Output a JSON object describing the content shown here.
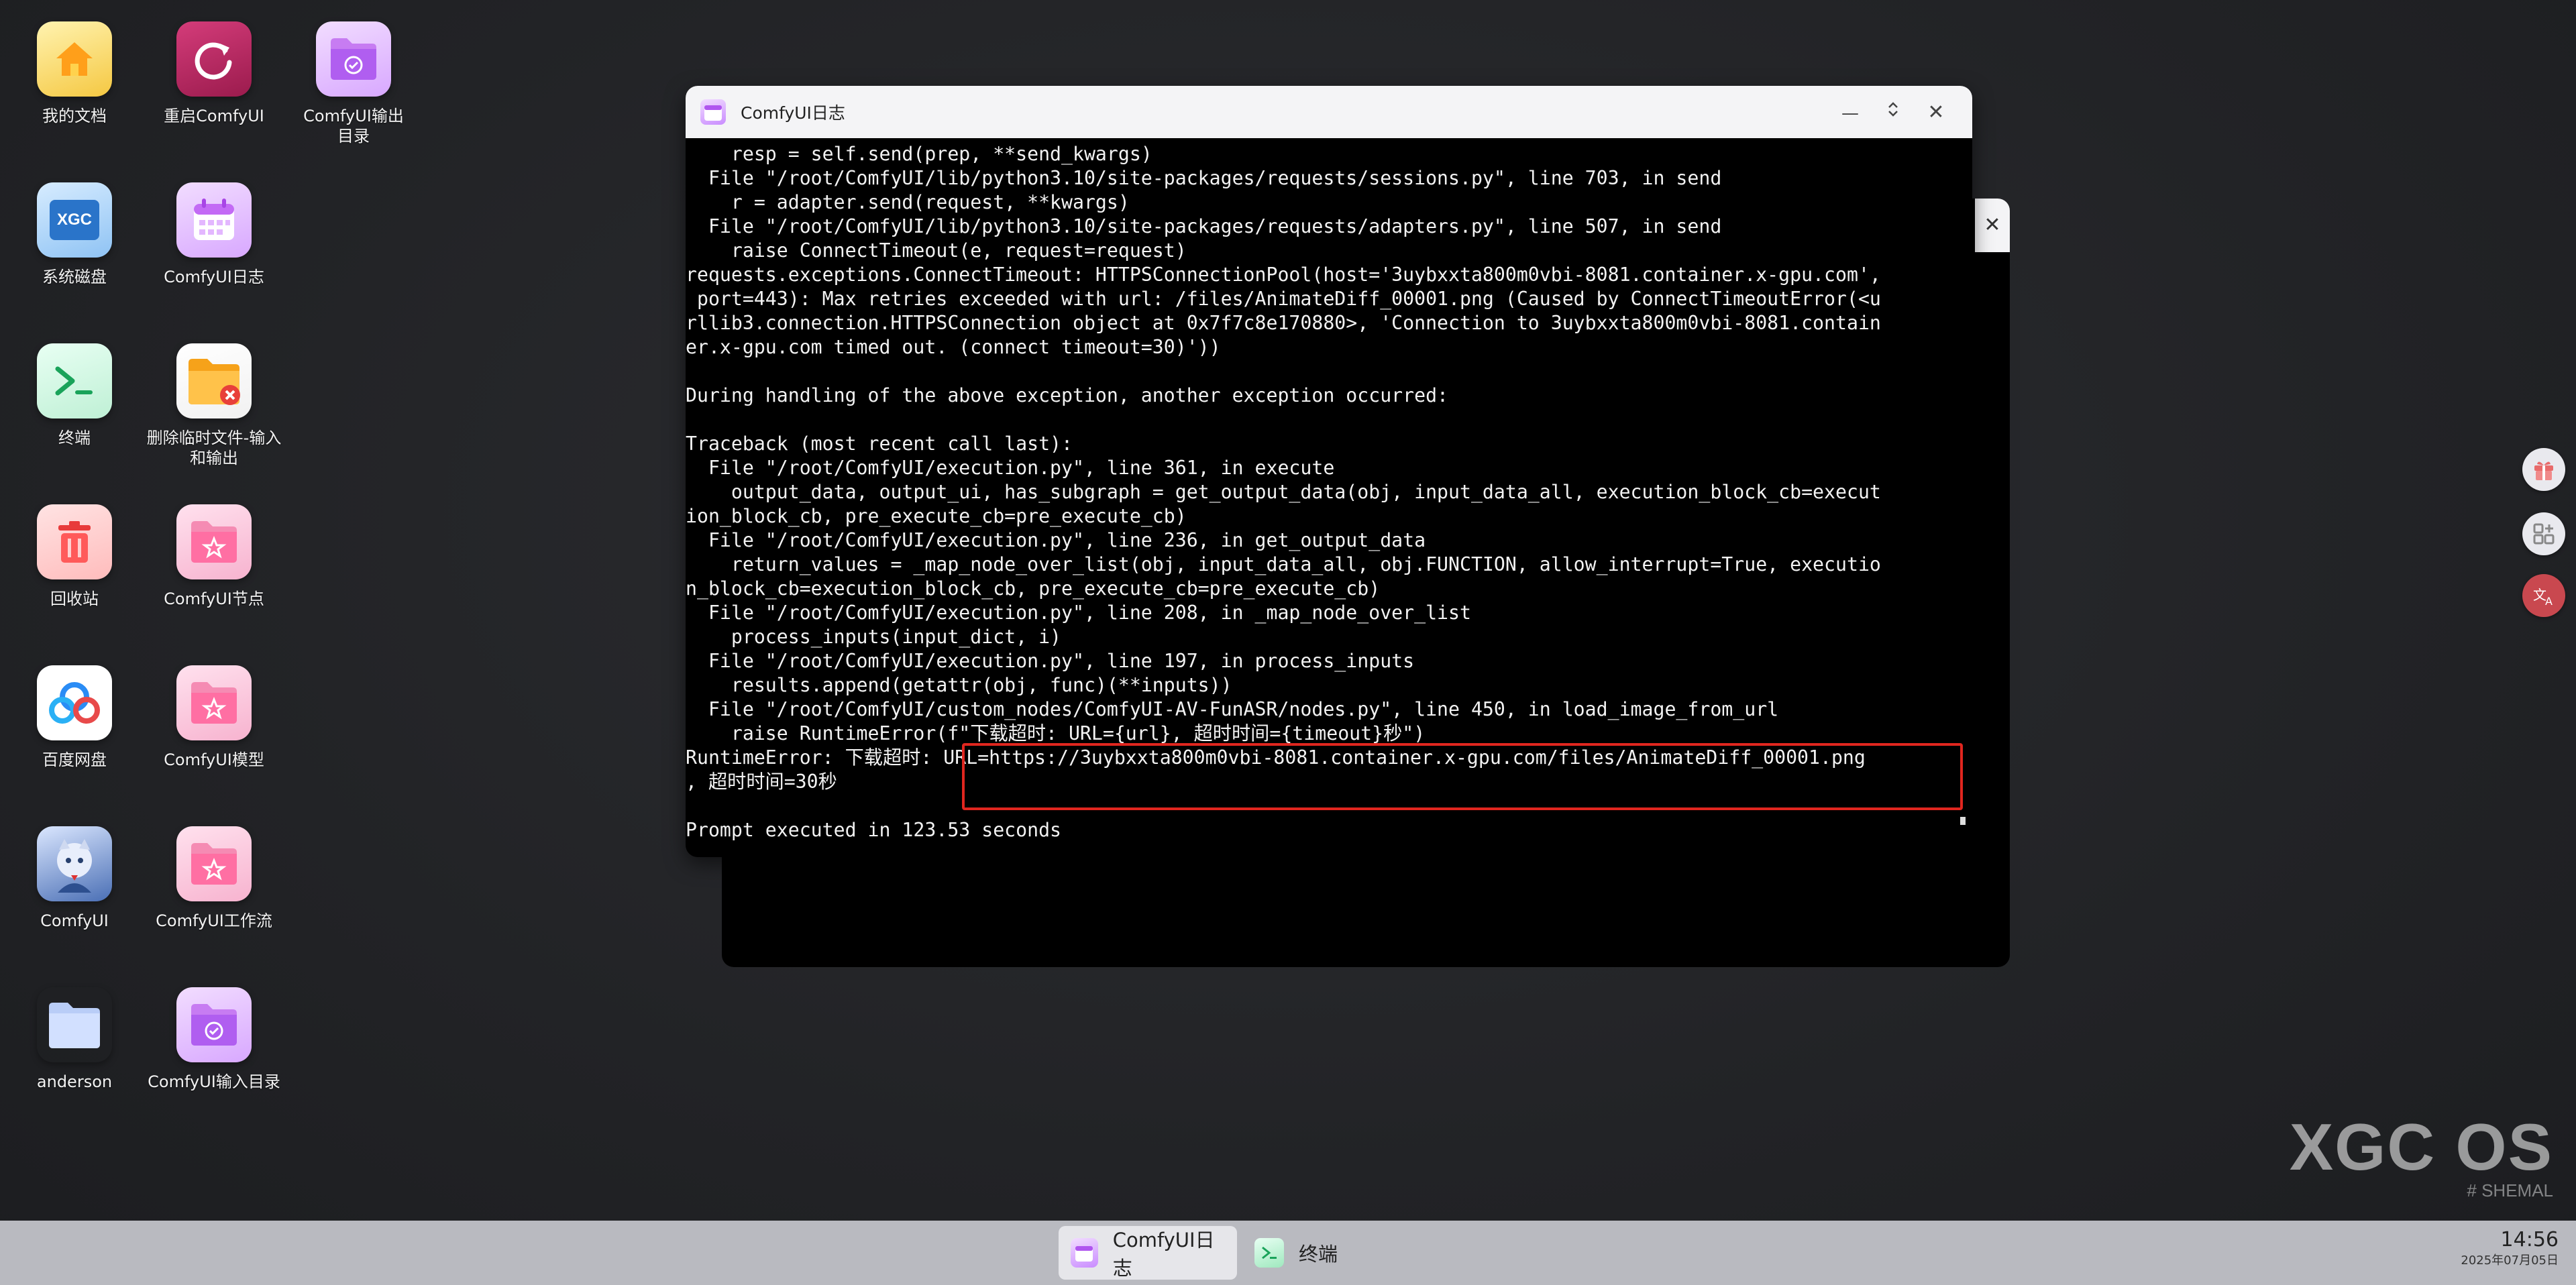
{
  "desktop_icons": [
    {
      "label": "我的文档"
    },
    {
      "label": "重启ComfyUI"
    },
    {
      "label": "ComfyUI输出目录"
    },
    {
      "label": "系统磁盘",
      "badge": "XGC"
    },
    {
      "label": "ComfyUI日志"
    },
    {
      "label": "终端"
    },
    {
      "label": "删除临时文件-输入和输出"
    },
    {
      "label": "回收站"
    },
    {
      "label": "ComfyUI节点"
    },
    {
      "label": "百度网盘"
    },
    {
      "label": "ComfyUI模型"
    },
    {
      "label": "ComfyUI"
    },
    {
      "label": "ComfyUI工作流"
    },
    {
      "label": "anderson"
    },
    {
      "label": "ComfyUI输入目录"
    }
  ],
  "window": {
    "title": "ComfyUI日志",
    "minimize": "—",
    "maximize": "⌃⌄",
    "close": "✕",
    "log": "    resp = self.send(prep, **send_kwargs)\n  File \"/root/ComfyUI/lib/python3.10/site-packages/requests/sessions.py\", line 703, in send\n    r = adapter.send(request, **kwargs)\n  File \"/root/ComfyUI/lib/python3.10/site-packages/requests/adapters.py\", line 507, in send\n    raise ConnectTimeout(e, request=request)\nrequests.exceptions.ConnectTimeout: HTTPSConnectionPool(host='3uybxxta800m0vbi-8081.container.x-gpu.com',\n port=443): Max retries exceeded with url: /files/AnimateDiff_00001.png (Caused by ConnectTimeoutError(<u\nrllib3.connection.HTTPSConnection object at 0x7f7c8e170880>, 'Connection to 3uybxxta800m0vbi-8081.contain\ner.x-gpu.com timed out. (connect timeout=30)'))\n\nDuring handling of the above exception, another exception occurred:\n\nTraceback (most recent call last):\n  File \"/root/ComfyUI/execution.py\", line 361, in execute\n    output_data, output_ui, has_subgraph = get_output_data(obj, input_data_all, execution_block_cb=execut\nion_block_cb, pre_execute_cb=pre_execute_cb)\n  File \"/root/ComfyUI/execution.py\", line 236, in get_output_data\n    return_values = _map_node_over_list(obj, input_data_all, obj.FUNCTION, allow_interrupt=True, executio\nn_block_cb=execution_block_cb, pre_execute_cb=pre_execute_cb)\n  File \"/root/ComfyUI/execution.py\", line 208, in _map_node_over_list\n    process_inputs(input_dict, i)\n  File \"/root/ComfyUI/execution.py\", line 197, in process_inputs\n    results.append(getattr(obj, func)(**inputs))\n  File \"/root/ComfyUI/custom_nodes/ComfyUI-AV-FunASR/nodes.py\", line 450, in load_image_from_url\n    raise RuntimeError(f\"下载超时: URL={url}, 超时时间={timeout}秒\")\nRuntimeError: 下载超时: URL=https://3uybxxta800m0vbi-8081.container.x-gpu.com/files/AnimateDiff_00001.png\n, 超时时间=30秒\n\nPrompt executed in 123.53 seconds"
  },
  "back_window": {
    "close": "✕"
  },
  "side_buttons": [
    {
      "icon": "gift-icon"
    },
    {
      "icon": "apps-icon"
    },
    {
      "icon": "translate-icon"
    }
  ],
  "watermark": {
    "title": "XGC OS",
    "subtitle": "# SHEMAL"
  },
  "taskbar": {
    "items": [
      {
        "label": "ComfyUI日志",
        "active": true
      },
      {
        "label": "终端",
        "active": false
      }
    ],
    "time": "14:56",
    "date": "2025年07月05日"
  },
  "colors": {
    "highlight": "#e0261f",
    "terminal_bg": "#000000",
    "taskbar_bg": "#b9bac0"
  }
}
